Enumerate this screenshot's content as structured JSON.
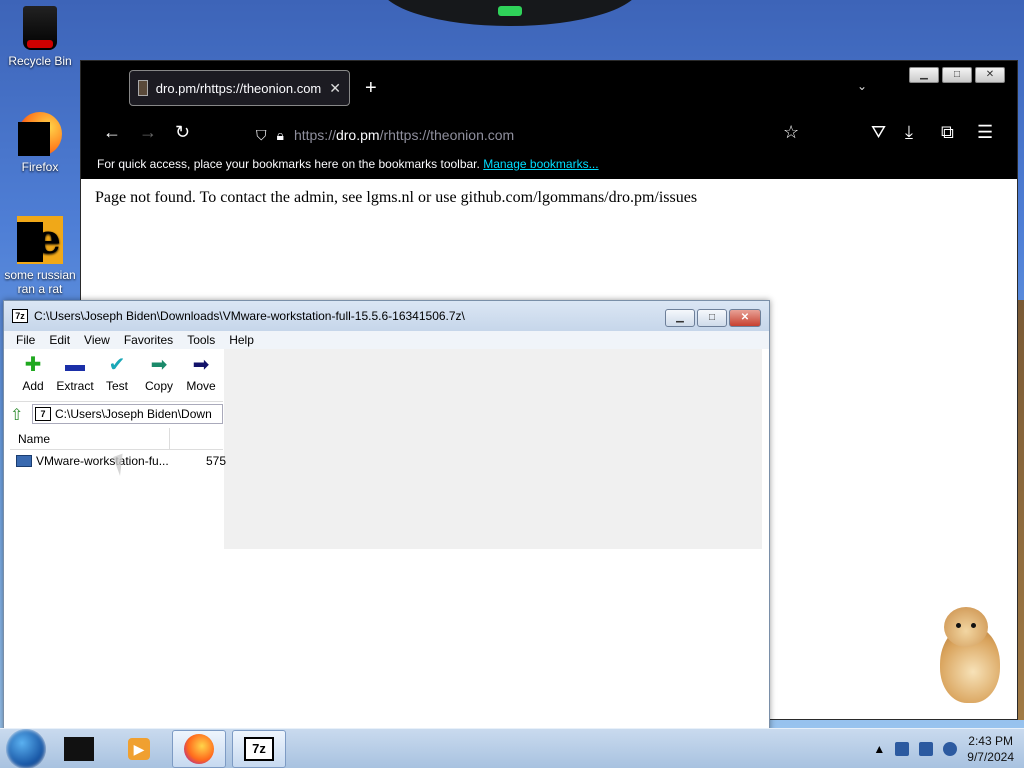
{
  "desktop": {
    "icons": [
      {
        "label": "Recycle Bin"
      },
      {
        "label": "Firefox"
      },
      {
        "label": "some russian ran a rat"
      }
    ]
  },
  "browser": {
    "tab_title": "dro.pm/rhttps://theonion.com",
    "url_host": "dro.pm",
    "url_prefix": "https://",
    "url_rest": "/rhttps://theonion.com",
    "bookmarks_prompt": "For quick access, place your bookmarks here on the bookmarks toolbar.",
    "manage_bookmarks": "Manage bookmarks...",
    "page_text": "Page not found. To contact the admin, see lgms.nl or use github.com/lgommans/dro.pm/issues"
  },
  "zip": {
    "title": "C:\\Users\\Joseph Biden\\Downloads\\VMware-workstation-full-15.5.6-16341506.7z\\",
    "menu": [
      "File",
      "Edit",
      "View",
      "Favorites",
      "Tools",
      "Help"
    ],
    "tools": [
      "Add",
      "Extract",
      "Test",
      "Copy",
      "Move"
    ],
    "address": "C:\\Users\\Joseph Biden\\Down",
    "columns": {
      "name": "Name"
    },
    "files": [
      {
        "name": "VMware-workstation-fu...",
        "size": "575"
      }
    ]
  },
  "taskbar": {
    "time": "2:43 PM",
    "date": "9/7/2024",
    "sevenzip_label": "7z"
  }
}
